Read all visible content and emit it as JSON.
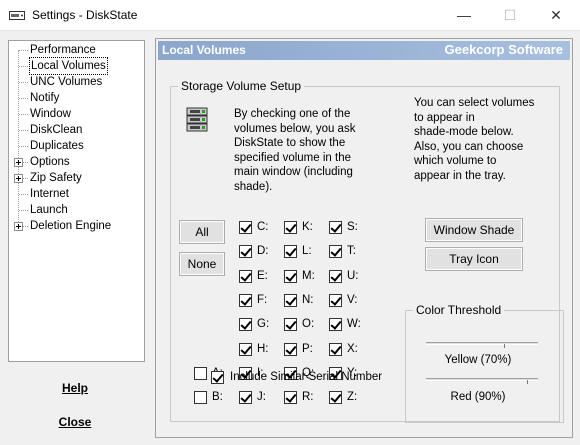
{
  "window": {
    "title": "Settings - DiskState",
    "minimize_glyph": "—",
    "maximize_glyph": "☐",
    "close_glyph": "✕"
  },
  "nav": {
    "items": [
      {
        "label": "Performance",
        "expandable": false
      },
      {
        "label": "Local Volumes",
        "expandable": false,
        "selected": true
      },
      {
        "label": "UNC Volumes",
        "expandable": false
      },
      {
        "label": "Notify",
        "expandable": false
      },
      {
        "label": "Window",
        "expandable": false
      },
      {
        "label": "DiskClean",
        "expandable": false
      },
      {
        "label": "Duplicates",
        "expandable": false
      },
      {
        "label": "Options",
        "expandable": true
      },
      {
        "label": "Zip Safety",
        "expandable": true
      },
      {
        "label": "Internet",
        "expandable": false
      },
      {
        "label": "Launch",
        "expandable": false
      },
      {
        "label": "Deletion Engine",
        "expandable": true
      }
    ]
  },
  "footer": {
    "help_label": "Help",
    "close_label": "Close"
  },
  "header": {
    "section_title": "Local Volumes",
    "brand": "Geekcorp Software"
  },
  "storage": {
    "group_title": "Storage Volume Setup",
    "description": [
      "By checking one of the",
      "volumes below, you ask",
      "DiskState to show the",
      "specified volume in the",
      "main window (including",
      "shade)."
    ],
    "right_description": [
      "You can select volumes",
      "to appear in",
      "shade-mode below.",
      "Also, you can choose",
      "which volume to",
      "appear in the tray."
    ],
    "all_label": "All",
    "none_label": "None",
    "window_shade_label": "Window Shade",
    "tray_icon_label": "Tray Icon",
    "include_serial_label": "Include Similar Serial Number",
    "include_serial_checked": true,
    "drives": [
      {
        "label": "A:",
        "checked": false
      },
      {
        "label": "B:",
        "checked": false
      },
      {
        "label": "C:",
        "checked": true
      },
      {
        "label": "D:",
        "checked": true
      },
      {
        "label": "E:",
        "checked": true
      },
      {
        "label": "F:",
        "checked": true
      },
      {
        "label": "G:",
        "checked": true
      },
      {
        "label": "H:",
        "checked": true
      },
      {
        "label": "I:",
        "checked": true
      },
      {
        "label": "J:",
        "checked": true
      },
      {
        "label": "K:",
        "checked": true
      },
      {
        "label": "L:",
        "checked": true
      },
      {
        "label": "M:",
        "checked": true
      },
      {
        "label": "N:",
        "checked": true
      },
      {
        "label": "O:",
        "checked": true
      },
      {
        "label": "P:",
        "checked": true
      },
      {
        "label": "Q:",
        "checked": true
      },
      {
        "label": "R:",
        "checked": true
      },
      {
        "label": "S:",
        "checked": true
      },
      {
        "label": "T:",
        "checked": true
      },
      {
        "label": "U:",
        "checked": true
      },
      {
        "label": "V:",
        "checked": true
      },
      {
        "label": "W:",
        "checked": true
      },
      {
        "label": "X:",
        "checked": true
      },
      {
        "label": "Y:",
        "checked": true
      },
      {
        "label": "Z:",
        "checked": true
      }
    ]
  },
  "threshold": {
    "group_title": "Color Threshold",
    "yellow_label": "Yellow (70%)",
    "yellow_value_percent": 70,
    "red_label": "Red (90%)",
    "red_value_percent": 90
  },
  "icons": {
    "app": "hard-drive-icon",
    "group": "drive-stack-icon"
  }
}
